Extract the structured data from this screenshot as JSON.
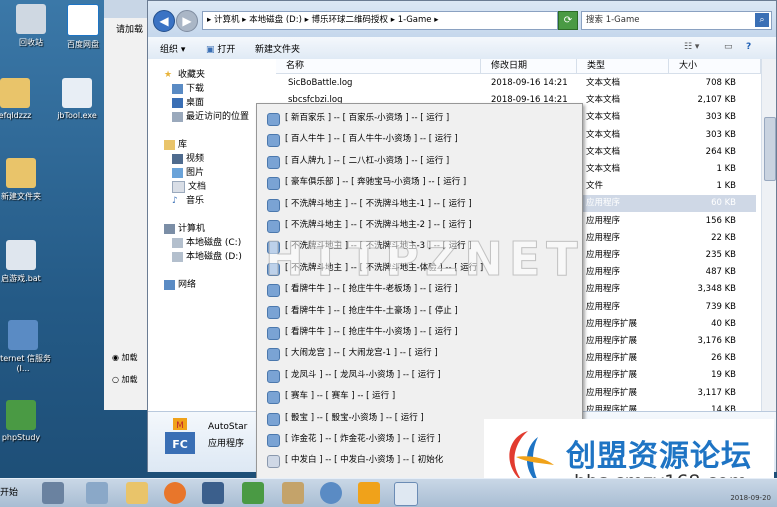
{
  "desktop": {
    "icons": [
      {
        "label": "回收站"
      },
      {
        "label": "百度网盘"
      },
      {
        "label": "efqldzzz"
      },
      {
        "label": "jbTool.exe"
      },
      {
        "label": "新建文件夹"
      },
      {
        "label": "启游戏.bat"
      },
      {
        "label": "nternet 信服务 (I..."
      },
      {
        "label": "phpStudy"
      }
    ]
  },
  "bg_window": {
    "label": "请加载",
    "radio1": "加载",
    "radio2": "加载"
  },
  "explorer": {
    "path": "▸ 计算机 ▸ 本地磁盘 (D:) ▸ 博乐环球二维码授权 ▸ 1-Game ▸",
    "search_placeholder": "搜索 1-Game",
    "toolbar": {
      "organize": "组织 ▾",
      "open": "打开",
      "new_folder": "新建文件夹"
    },
    "nav": {
      "favorites": "收藏夹",
      "downloads": "下载",
      "desktop": "桌面",
      "recent": "最近访问的位置",
      "library": "库",
      "video": "视频",
      "pictures": "图片",
      "documents": "文档",
      "music": "音乐",
      "computer": "计算机",
      "local_c": "本地磁盘 (C:)",
      "local_d": "本地磁盘 (D:)",
      "network": "网络"
    },
    "columns": {
      "name": "名称",
      "date": "修改日期",
      "type": "类型",
      "size": "大小"
    },
    "rows": [
      {
        "name": "SicBoBattle.log",
        "date": "2018-09-16 14:21",
        "type": "文本文档",
        "size": "708 KB"
      },
      {
        "name": "sbcsfcbzi.log",
        "date": "2018-09-16 14:21",
        "type": "文本文档",
        "size": "2,107 KB"
      },
      {
        "name": "",
        "date": "",
        "type": "文本文档",
        "size": "303 KB"
      },
      {
        "name": "",
        "date": "",
        "type": "文本文档",
        "size": "303 KB"
      },
      {
        "name": "",
        "date": "",
        "type": "文本文档",
        "size": "264 KB"
      },
      {
        "name": "",
        "date": "",
        "type": "文本文档",
        "size": "1 KB"
      },
      {
        "name": "",
        "date": "",
        "type": "文件",
        "size": "1 KB"
      },
      {
        "name": "",
        "date": "",
        "type": "应用程序",
        "size": "60 KB"
      },
      {
        "name": "",
        "date": "",
        "type": "应用程序",
        "size": "156 KB"
      },
      {
        "name": "",
        "date": "",
        "type": "应用程序",
        "size": "22 KB"
      },
      {
        "name": "",
        "date": "",
        "type": "应用程序",
        "size": "235 KB"
      },
      {
        "name": "",
        "date": "",
        "type": "应用程序",
        "size": "487 KB"
      },
      {
        "name": "",
        "date": "",
        "type": "应用程序",
        "size": "3,348 KB"
      },
      {
        "name": "",
        "date": "",
        "type": "应用程序",
        "size": "739 KB"
      },
      {
        "name": "",
        "date": "",
        "type": "应用程序扩展",
        "size": "40 KB"
      },
      {
        "name": "",
        "date": "",
        "type": "应用程序扩展",
        "size": "3,176 KB"
      },
      {
        "name": "",
        "date": "",
        "type": "应用程序扩展",
        "size": "26 KB"
      },
      {
        "name": "",
        "date": "",
        "type": "应用程序扩展",
        "size": "19 KB"
      },
      {
        "name": "",
        "date": "",
        "type": "应用程序扩展",
        "size": "3,117 KB"
      },
      {
        "name": "",
        "date": "",
        "type": "应用程序扩展",
        "size": "14 KB"
      }
    ],
    "details": {
      "name": "AutoStar",
      "type": "应用程序"
    }
  },
  "context_menu": [
    "[ 新百家乐 ] -- [ 百家乐-小资场 ] -- [ 运行 ]",
    "[ 百人牛牛 ] -- [ 百人牛牛-小资场 ] -- [ 运行 ]",
    "[ 百人牌九 ] -- [ 二八杠-小资场 ] -- [ 运行 ]",
    "[ 豪车俱乐部 ] -- [ 奔驰宝马-小资场 ] -- [ 运行 ]",
    "[ 不洗牌斗地主 ] -- [ 不洗牌斗地主-1 ] -- [ 运行 ]",
    "[ 不洗牌斗地主 ] -- [ 不洗牌斗地主-2 ] -- [ 运行 ]",
    "[ 不洗牌斗地主 ] -- [ 不洗牌斗地主-3 ] -- [ 运行 ]",
    "[ 不洗牌斗地主 ] -- [ 不洗牌斗地主-体验 ] -- [ 运行 ]",
    "[ 看牌牛牛 ] -- [ 抢庄牛牛-老板场 ] -- [ 运行 ]",
    "[ 看牌牛牛 ] -- [ 抢庄牛牛-土豪场 ] -- [ 停止 ]",
    "[ 看牌牛牛 ] -- [ 抢庄牛牛-小资场 ] -- [ 运行 ]",
    "[ 大闹龙宫 ] -- [ 大闹龙宫-1 ] -- [ 运行 ]",
    "[ 龙凤斗 ] -- [ 龙凤斗-小资场 ] -- [ 运行 ]",
    "[ 赛车 ] -- [ 赛车 ] -- [ 运行 ]",
    "[ 骰宝 ] -- [ 骰宝-小资场 ] -- [ 运行 ]",
    "[ 诈金花 ] -- [ 炸金花-小资场 ] -- [ 运行 ]",
    "[ 中发白 ] -- [ 中发白-小资场 ] -- [ 初始化"
  ],
  "watermark": "HTTPZNET",
  "forum": {
    "name": "创盟资源论坛",
    "url": "bbs.cmzy168.com"
  },
  "taskbar": {
    "start": "开始",
    "clock": "2018-09-20"
  }
}
